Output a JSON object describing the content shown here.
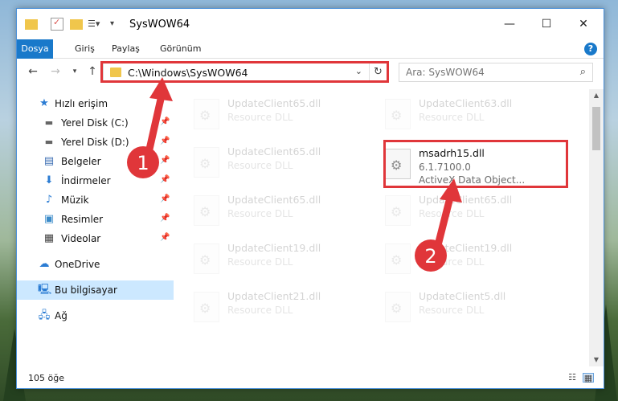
{
  "window": {
    "title": "SysWOW64",
    "controls": {
      "minimize": "—",
      "maximize": "☐",
      "close": "✕"
    }
  },
  "ribbon": {
    "tabs": [
      {
        "label": "Dosya",
        "active": true
      },
      {
        "label": "Giriş"
      },
      {
        "label": "Paylaş"
      },
      {
        "label": "Görünüm"
      }
    ],
    "help": "?"
  },
  "address_bar": {
    "path": "C:\\Windows\\SysWOW64",
    "search_placeholder": "Ara: SysWOW64"
  },
  "sidebar": {
    "items": [
      {
        "label": "Hızlı erişim",
        "icon": "star-icon",
        "pinned": false
      },
      {
        "label": "Yerel Disk (C:)",
        "icon": "drive-icon",
        "pinned": true
      },
      {
        "label": "Yerel Disk (D:)",
        "icon": "drive-icon",
        "pinned": true
      },
      {
        "label": "Belgeler",
        "icon": "documents-icon",
        "pinned": true
      },
      {
        "label": "İndirmeler",
        "icon": "downloads-icon",
        "pinned": true
      },
      {
        "label": "Müzik",
        "icon": "music-icon",
        "pinned": true
      },
      {
        "label": "Resimler",
        "icon": "pictures-icon",
        "pinned": true
      },
      {
        "label": "Videolar",
        "icon": "videos-icon",
        "pinned": true
      },
      {
        "label": "OneDrive",
        "icon": "cloud-icon",
        "pinned": false
      },
      {
        "label": "Bu bilgisayar",
        "icon": "computer-icon",
        "pinned": false,
        "selected": true
      },
      {
        "label": "Ağ",
        "icon": "network-icon",
        "pinned": false
      }
    ]
  },
  "files": {
    "left_column": [
      {
        "name": "UpdateClient65.dll",
        "type": "Resource DLL"
      },
      {
        "name": "UpdateClient65.dll",
        "type": "Resource DLL"
      },
      {
        "name": "UpdateClient65.dll",
        "type": "Resource DLL"
      },
      {
        "name": "UpdateClient19.dll",
        "type": "Resource DLL"
      },
      {
        "name": "UpdateClient21.dll",
        "type": "Resource DLL"
      }
    ],
    "right_column": [
      {
        "name": "UpdateClient63.dll",
        "type": "Resource DLL"
      },
      {
        "name": "msadrh15.dll",
        "version": "6.1.7100.0",
        "type": "ActiveX Data Object...",
        "highlighted": true
      },
      {
        "name": "UpdateClient65.dll",
        "type": "Resource DLL"
      },
      {
        "name": "UpdateClient19.dll",
        "type": "Resource DLL"
      },
      {
        "name": "UpdateClient5.dll",
        "type": "Resource DLL"
      }
    ]
  },
  "status": {
    "item_count": "105 öğe"
  },
  "annotations": {
    "step1": "1",
    "step2": "2",
    "color": "#e0363a"
  }
}
